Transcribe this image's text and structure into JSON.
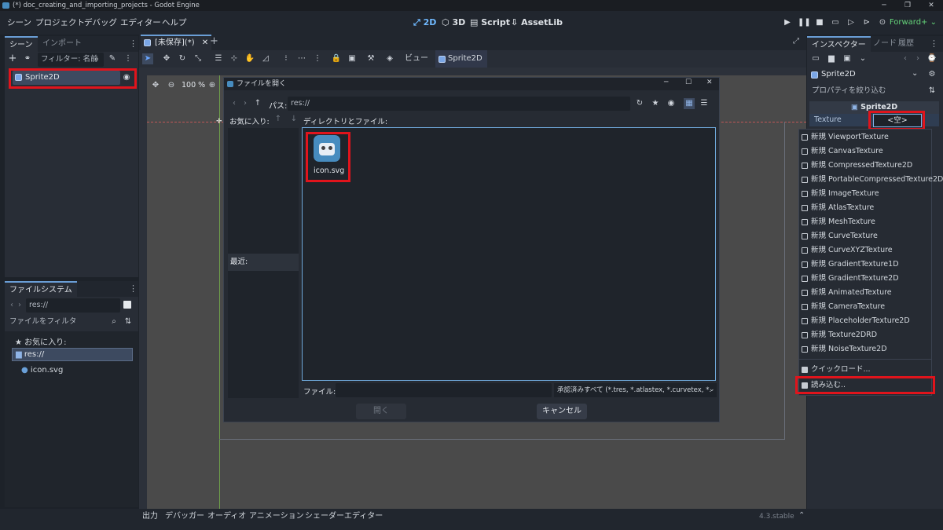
{
  "window": {
    "title": "(*) doc_creating_and_importing_projects - Godot Engine"
  },
  "menu": [
    "シーン",
    "プロジェクト",
    "デバッグ",
    "エディター",
    "ヘルプ"
  ],
  "workspaces": {
    "w2d": "2D",
    "w3d": "3D",
    "script": "Script",
    "assetlib": "AssetLib"
  },
  "renderer": "Forward+",
  "scene_dock": {
    "tabs": [
      "シーン",
      "インポート"
    ],
    "filter_placeholder": "フィルター: 名前",
    "node": "Sprite2D"
  },
  "filesystem_dock": {
    "tab": "ファイルシステム",
    "path": "res://",
    "filter_placeholder": "ファイルをフィルタ",
    "favorites": "お気に入り:",
    "root": "res://",
    "file": "icon.svg"
  },
  "editor_tab": {
    "label": "[未保存](*)"
  },
  "toolbar": {
    "view_label": "ビュー",
    "sprite_button": "Sprite2D"
  },
  "zoom": "100 %",
  "dialog": {
    "title": "ファイルを開く",
    "path_label": "パス:",
    "path_value": "res://",
    "favorites_label": "お気に入り:",
    "dirs_label": "ディレクトリとファイル:",
    "recent_label": "最近:",
    "file_name": "icon.svg",
    "file_label": "ファイル:",
    "filter": "承認済みすべて (*.tres, *.atlastex, *.curvetex, *.",
    "open": "開く",
    "cancel": "キャンセル"
  },
  "inspector": {
    "tabs": [
      "インスペクター",
      "ノード",
      "履歴"
    ],
    "node": "Sprite2D",
    "filter_placeholder": "プロパティを絞り込む",
    "section": "Sprite2D",
    "texture_label": "Texture",
    "texture_value": "<空>"
  },
  "texture_menu": {
    "items": [
      "新規 ViewportTexture",
      "新規 CanvasTexture",
      "新規 CompressedTexture2D",
      "新規 PortableCompressedTexture2D",
      "新規 ImageTexture",
      "新規 AtlasTexture",
      "新規 MeshTexture",
      "新規 CurveTexture",
      "新規 CurveXYZTexture",
      "新規 GradientTexture1D",
      "新規 GradientTexture2D",
      "新規 AnimatedTexture",
      "新規 CameraTexture",
      "新規 PlaceholderTexture2D",
      "新規 Texture2DRD",
      "新規 NoiseTexture2D"
    ],
    "quickload": "クイックロード...",
    "load": "読み込む.."
  },
  "bottom_tabs": [
    "出力",
    "デバッガー",
    "オーディオ",
    "アニメーション",
    "シェーダーエディター"
  ],
  "version": "4.3.stable",
  "colors": {
    "accent": "#70b9ff",
    "highlight": "#e0141c",
    "renderer": "#65d57a"
  }
}
